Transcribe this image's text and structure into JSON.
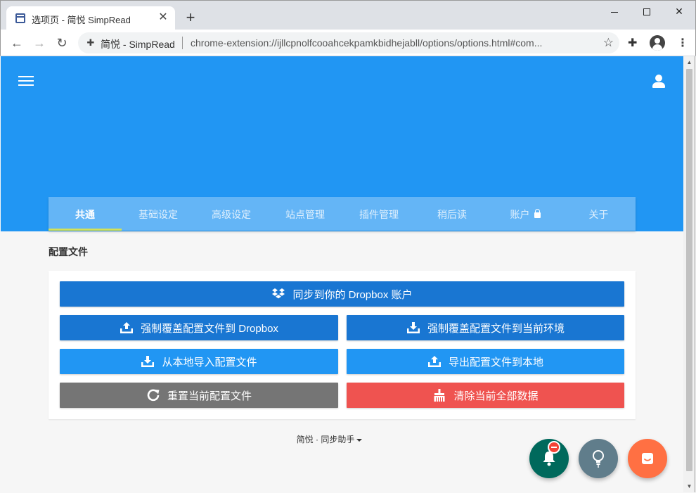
{
  "browser": {
    "tab_title": "选项页 - 简悦 SimpRead",
    "site_name": "简悦 - SimpRead",
    "url": "chrome-extension://ijllcpnolfcooahcekpamkbidhejabll/options/options.html#com..."
  },
  "nav": {
    "tabs": [
      {
        "label": "共通"
      },
      {
        "label": "基础设定"
      },
      {
        "label": "高级设定"
      },
      {
        "label": "站点管理"
      },
      {
        "label": "插件管理"
      },
      {
        "label": "稍后读"
      },
      {
        "label": "账户"
      },
      {
        "label": "关于"
      }
    ],
    "active_index": 0
  },
  "section": {
    "title": "配置文件"
  },
  "buttons": {
    "sync": "同步到你的 Dropbox 账户",
    "force_upload": "强制覆盖配置文件到 Dropbox",
    "force_download": "强制覆盖配置文件到当前环境",
    "import_local": "从本地导入配置文件",
    "export_local": "导出配置文件到本地",
    "reset": "重置当前配置文件",
    "clear": "清除当前全部数据"
  },
  "footer": {
    "link": "简悦 · 同步助手"
  },
  "colors": {
    "header": "#2196f3",
    "tabs_bar": "#64b5f6",
    "indicator": "#d4e157",
    "btn_dark": "#1976d2",
    "btn_light": "#2196f3",
    "btn_grey": "#757575",
    "btn_red": "#ef5350",
    "fab_bell": "#00695c",
    "fab_bulb": "#607d8b",
    "fab_chat": "#ff7043"
  },
  "icons": {
    "dropbox": "dropbox-icon",
    "upload": "upload-icon",
    "download": "download-icon",
    "reset": "refresh-icon",
    "clear": "broom-icon",
    "bell": "bell-icon",
    "bulb": "lightbulb-icon",
    "chat": "chat-icon"
  }
}
